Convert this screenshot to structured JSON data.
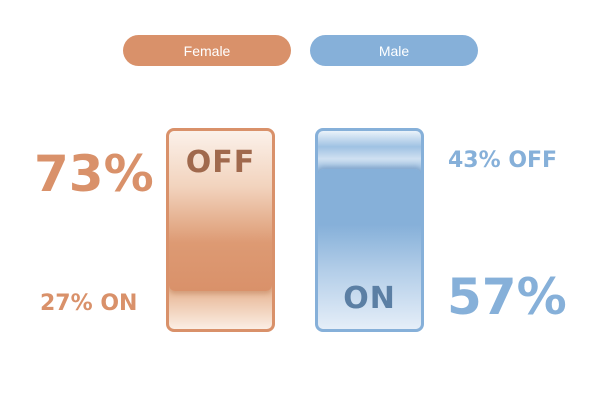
{
  "legend": [
    {
      "label": "Female",
      "color": "#d9916a"
    },
    {
      "label": "Male",
      "color": "#86b0d9"
    }
  ],
  "switches": {
    "female": {
      "state_label": "OFF",
      "state": "off",
      "color": "#d9916a"
    },
    "male": {
      "state_label": "ON",
      "state": "on",
      "color": "#86b0d9"
    }
  },
  "stats": {
    "female_off": "73%",
    "female_on": "27% ON",
    "male_off": "43% OFF",
    "male_on": "57%"
  }
}
